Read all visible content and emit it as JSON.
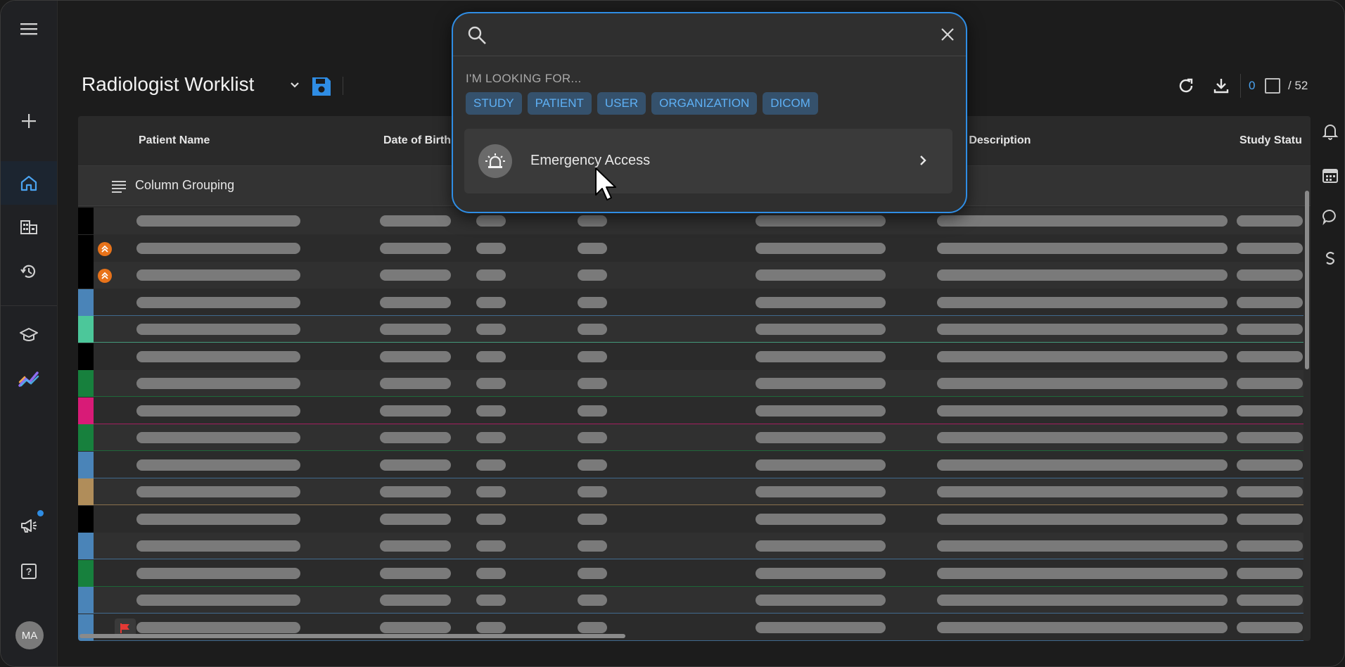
{
  "header": {
    "title": "Radiologist Worklist",
    "selected_count": "0",
    "total_label": "/ 52"
  },
  "sidebar": {
    "avatar_initials": "MA",
    "items": [
      "menu",
      "add",
      "home",
      "organizations",
      "history",
      "teaching",
      "analytics",
      "announcements",
      "help"
    ]
  },
  "table": {
    "columns": [
      "Patient Name",
      "Date of Birth",
      "y Description",
      "Study Statu"
    ],
    "group_label": "Column Grouping"
  },
  "search": {
    "placeholder": "",
    "looking_for": "I'M LOOKING FOR...",
    "chips": [
      "STUDY",
      "PATIENT",
      "USER",
      "ORGANIZATION",
      "DICOM"
    ],
    "result_label": "Emergency Access"
  },
  "colors": {
    "accent": "#2f8de4",
    "priority": "#e8731a",
    "flag": "#e53935",
    "row_bars": [
      "#000000",
      "#000000",
      "#000000",
      "#4a84b8",
      "#4cc79a",
      "#000000",
      "#17803d",
      "#d81b77",
      "#17803d",
      "#4a84b8",
      "#b08d5a",
      "#000000",
      "#4a84b8",
      "#17803d",
      "#4a84b8",
      "#4a84b8"
    ]
  }
}
